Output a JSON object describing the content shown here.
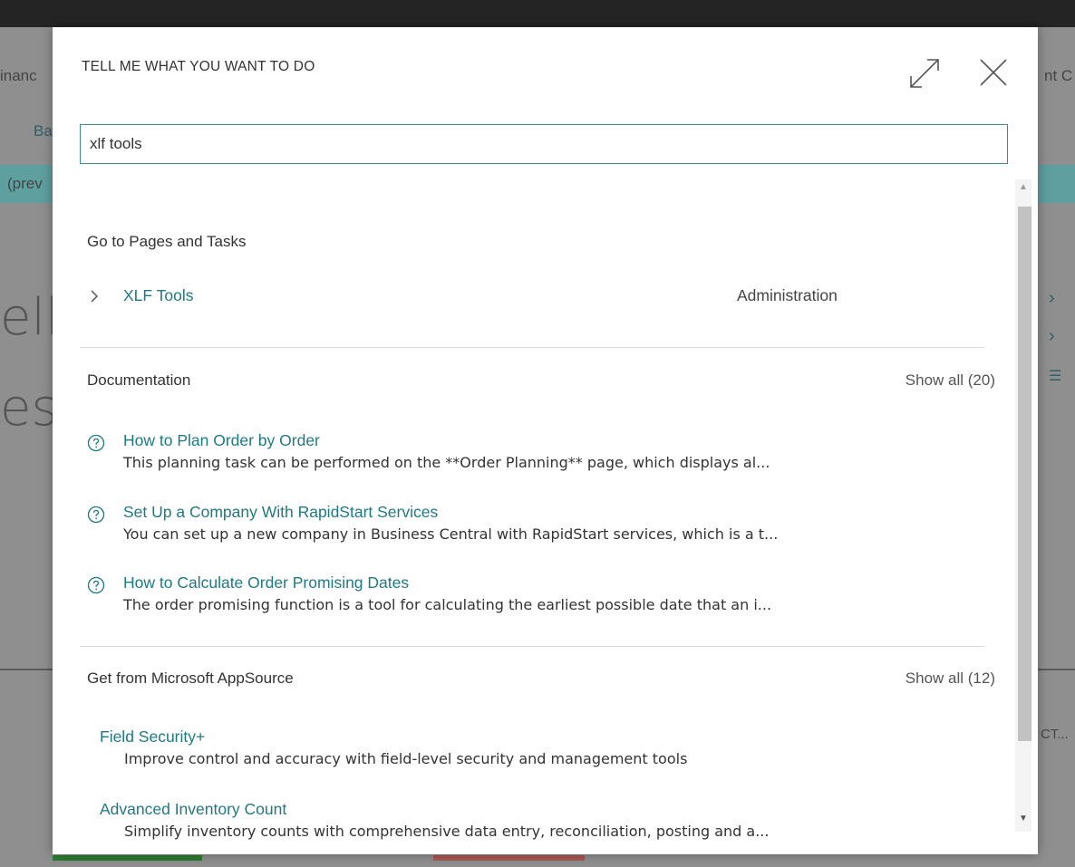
{
  "background": {
    "left_fragments": [
      "inanc",
      "Ba",
      "(prev",
      "ell",
      "es"
    ],
    "right_fragments": [
      "nt C",
      "CT..."
    ]
  },
  "dialog": {
    "title": "TELL ME WHAT YOU WANT TO DO",
    "search_value": "xlf tools"
  },
  "sections": {
    "pages": {
      "heading": "Go to Pages and Tasks",
      "item": {
        "label": "XLF Tools",
        "category": "Administration"
      }
    },
    "documentation": {
      "heading": "Documentation",
      "show_all": "Show all (20)",
      "items": [
        {
          "title": "How to Plan Order by Order",
          "desc": "This planning task can be performed on the **Order Planning** page, which displays al..."
        },
        {
          "title": "Set Up a Company With RapidStart Services",
          "desc": "You can set up a new company in Business Central with RapidStart services, which is a t..."
        },
        {
          "title": "How to Calculate Order Promising Dates",
          "desc": "The order promising function is a tool for calculating the earliest possible date that an i..."
        }
      ]
    },
    "appsource": {
      "heading": "Get from Microsoft AppSource",
      "show_all": "Show all (12)",
      "items": [
        {
          "title": "Field Security+",
          "desc": "Improve control and accuracy with field-level security and management tools"
        },
        {
          "title": "Advanced Inventory Count",
          "desc": "Simplify inventory counts with comprehensive data entry, reconciliation, posting and a..."
        }
      ]
    }
  },
  "colors": {
    "accent": "#1f7a80",
    "search_border": "#3e8d8e"
  },
  "icons": [
    "expand-icon",
    "close-icon",
    "chevron-right-icon",
    "help-icon",
    "scroll-up-icon",
    "scroll-down-icon"
  ]
}
